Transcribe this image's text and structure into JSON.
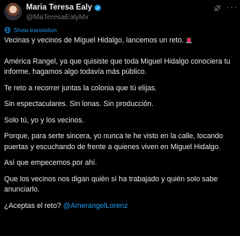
{
  "author": {
    "display_name": "Maria Teresa Ealy",
    "handle": "@MaTeresaEalyMx",
    "verified_color": "#1d9bf0"
  },
  "actions": {
    "grok_icon": "grok-icon",
    "more_label": "···"
  },
  "translation": {
    "label": "Show translation"
  },
  "tweet": {
    "paragraphs": [
      "Vecinas y vecinos de Miguel Hidalgo, lancemos un reto.",
      "América Rangel, ya que quisiste que toda Miguel Hidalgo conociera tu informe, hagamos algo todavía más público.",
      "Te reto a recorrer juntas la colonia que tú elijas.",
      "Sin espectaculares. Sin lonas. Sin producción.",
      "Solo tú, yo y los vecinos.",
      "Porque, para serte sincera, yo nunca te he visto en la calle, tocando puertas y escuchando de frente a quienes viven en Miguel Hidalgo.",
      "Así que empecemos por ahí.",
      "Que los vecinos nos digan quién sí ha trabajado y quién solo sabe anunciarlo."
    ],
    "closing_question": "¿Aceptas el reto?",
    "mention": "@AmerangelLorenz",
    "emoji": "police-siren-emoji"
  },
  "colors": {
    "background": "#000000",
    "text": "#e7e9ea",
    "secondary": "#71767b",
    "accent": "#1d9bf0"
  }
}
